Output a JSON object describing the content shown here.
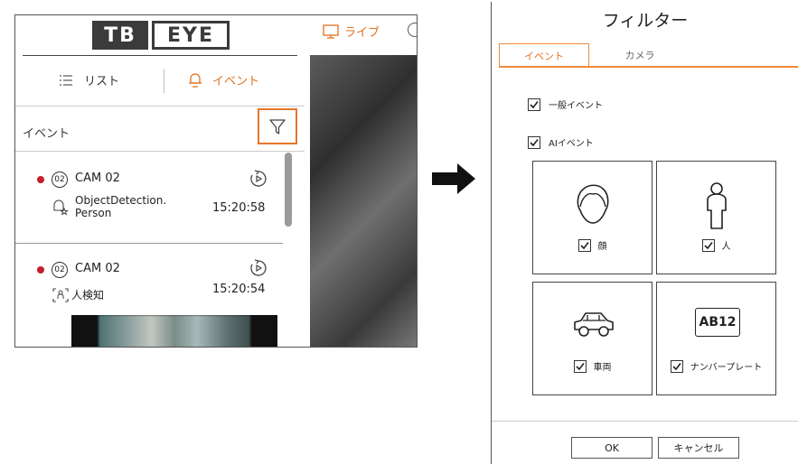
{
  "left_panel": {
    "logo": {
      "part1": "TB",
      "part2": "EYE"
    },
    "live_label": "ライブ",
    "tabs": {
      "list_label": "リスト",
      "event_label": "イベント"
    },
    "heading": "イベント",
    "events": [
      {
        "channel": "02",
        "camera": "CAM 02",
        "type_line1": "ObjectDetection.",
        "type_line2": "Person",
        "time": "15:20:58"
      },
      {
        "channel": "02",
        "camera": "CAM 02",
        "type_line1": "人検知",
        "time": "15:20:54"
      }
    ]
  },
  "dialog": {
    "title": "フィルター",
    "tabs": [
      "イベント",
      "カメラ"
    ],
    "general_event_label": "一般イベント",
    "ai_event_label": "AIイベント",
    "cards": [
      {
        "label": "顔",
        "icon": "face-icon"
      },
      {
        "label": "人",
        "icon": "person-icon"
      },
      {
        "label": "車両",
        "icon": "car-icon"
      },
      {
        "label": "ナンバープレート",
        "icon": "license-plate-icon",
        "icon_text": "AB12"
      }
    ],
    "ok_label": "OK",
    "cancel_label": "キャンセル"
  },
  "colors": {
    "accent": "#e07020",
    "record_dot": "#c41e2a"
  }
}
